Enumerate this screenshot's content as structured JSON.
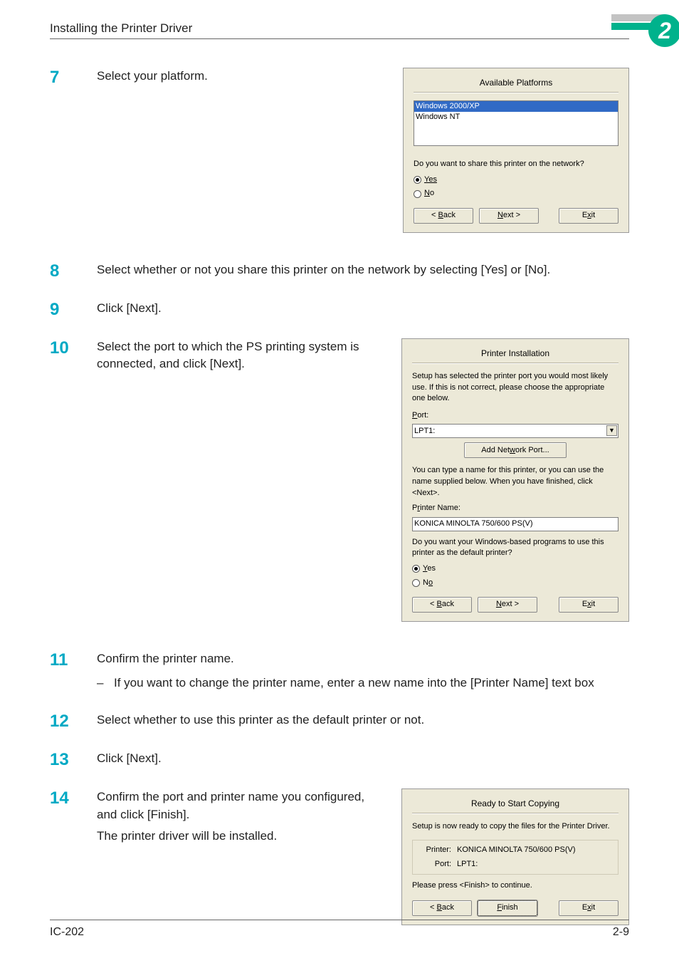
{
  "header": {
    "section_title": "Installing the Printer Driver"
  },
  "badge_number": "2",
  "steps": {
    "s7": {
      "num": "7",
      "text": "Select your platform."
    },
    "s8": {
      "num": "8",
      "text": "Select whether or not you share this printer on the network by selecting [Yes] or [No]."
    },
    "s9": {
      "num": "9",
      "text": "Click [Next]."
    },
    "s10": {
      "num": "10",
      "text": "Select the port to which the PS printing system is connected, and click [Next]."
    },
    "s11": {
      "num": "11",
      "text": "Confirm the printer name.",
      "sub": "If you want to change the printer name, enter a new name into the [Printer Name] text box"
    },
    "s12": {
      "num": "12",
      "text": "Select whether to use this printer as the default printer or not."
    },
    "s13": {
      "num": "13",
      "text": "Click [Next]."
    },
    "s14": {
      "num": "14",
      "text1": "Confirm the port and printer name you configured, and click [Finish].",
      "text2": "The printer driver will be installed."
    }
  },
  "dlg1": {
    "title": "Available Platforms",
    "item_sel": "Windows 2000/XP",
    "item_2": "Windows NT",
    "share_q": "Do you want to share this printer on the network?",
    "yes": "Yes",
    "no": "No",
    "back": "< Back",
    "next": "Next >",
    "exit": "Exit"
  },
  "dlg2": {
    "title": "Printer Installation",
    "intro": "Setup has selected the printer port you would most likely use. If this is not correct, please choose the appropriate one below.",
    "port_label": "Port:",
    "port_value": "LPT1:",
    "add_port": "Add Network Port...",
    "name_help": "You can type a name for this printer, or you can use the name supplied below. When you have finished, click <Next>.",
    "pn_label": "Printer Name:",
    "pn_value": "KONICA MINOLTA 750/600 PS(V)",
    "default_q": "Do you want your Windows-based programs to use this printer as the default printer?",
    "yes": "Yes",
    "no": "No",
    "back": "< Back",
    "next": "Next >",
    "exit": "Exit"
  },
  "dlg3": {
    "title": "Ready to Start Copying",
    "ready": "Setup is now ready to copy the files for the Printer Driver.",
    "printer_label": "Printer:",
    "printer_value": "KONICA MINOLTA 750/600 PS(V)",
    "port_label": "Port:",
    "port_value": "LPT1:",
    "press": "Please press <Finish> to continue.",
    "back": "< Back",
    "finish": "Finish",
    "exit": "Exit"
  },
  "footer": {
    "left": "IC-202",
    "right": "2-9"
  },
  "dash": "–"
}
